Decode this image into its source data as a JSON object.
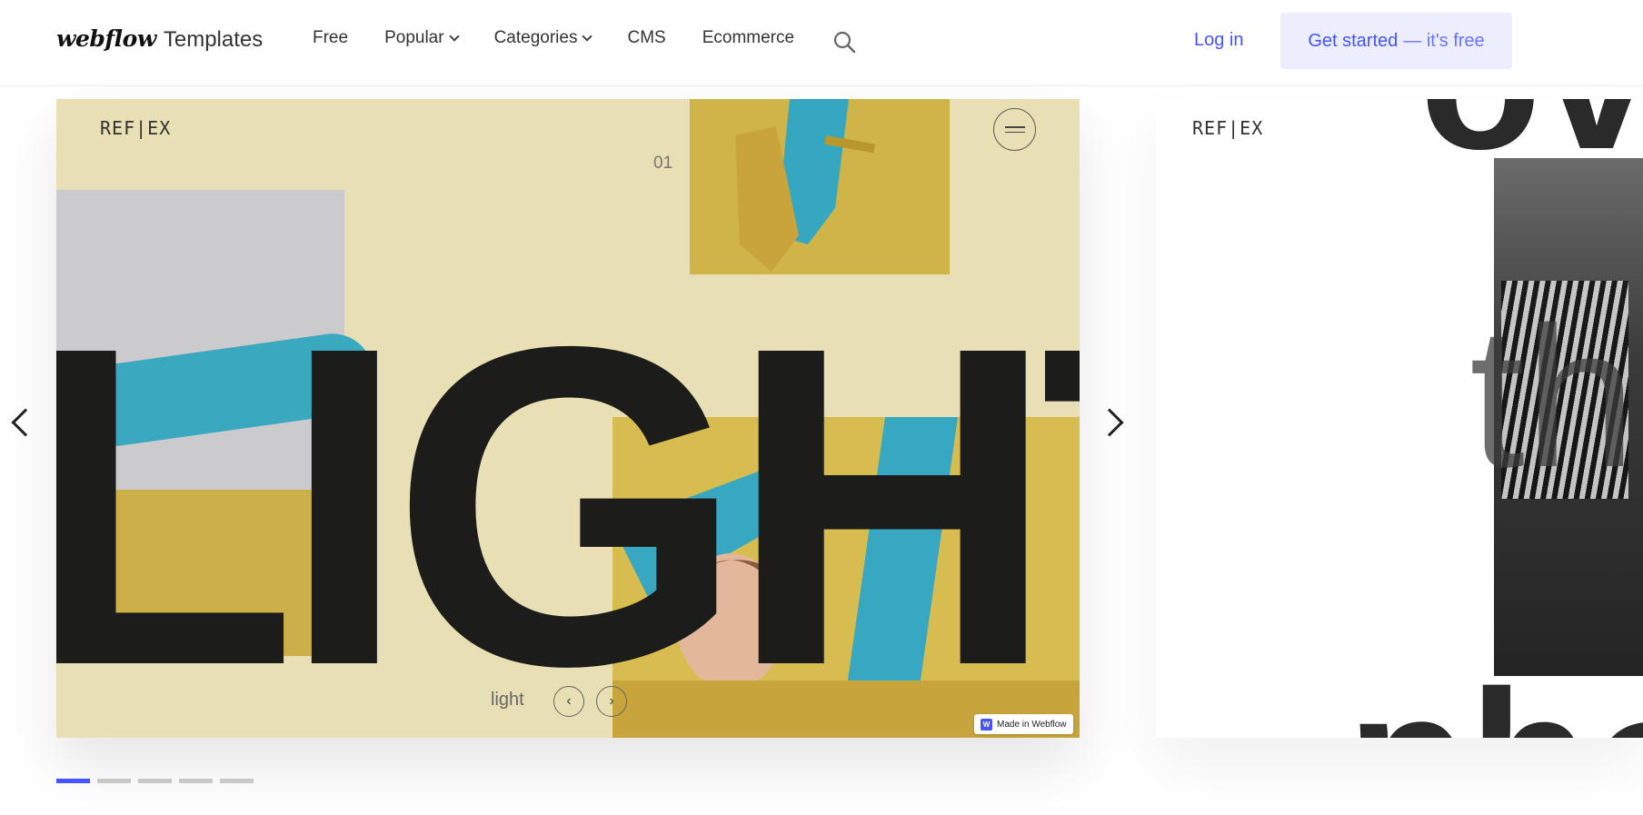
{
  "header": {
    "logo": "webflow",
    "logo_sub": "Templates",
    "nav": [
      {
        "label": "Free",
        "dropdown": false
      },
      {
        "label": "Popular",
        "dropdown": true
      },
      {
        "label": "Categories",
        "dropdown": true
      },
      {
        "label": "CMS",
        "dropdown": false
      },
      {
        "label": "Ecommerce",
        "dropdown": false
      }
    ],
    "login": "Log in",
    "cta": "Get started",
    "cta_sub": "— it's free"
  },
  "slide": {
    "logo": "REF|EX",
    "number": "01",
    "headline": "LIGHT",
    "caption": "light",
    "prev_ctrl": "‹",
    "next_ctrl": "›",
    "badge_logo": "W",
    "badge": "Made in Webflow"
  },
  "next_slide": {
    "logo": "REF|EX"
  },
  "carousel": {
    "dot_count": 5,
    "active_dot": 0
  },
  "colors": {
    "accent": "#4353ff",
    "slide_bg": "#e8dfb5",
    "cta_bg": "#eceefe"
  }
}
